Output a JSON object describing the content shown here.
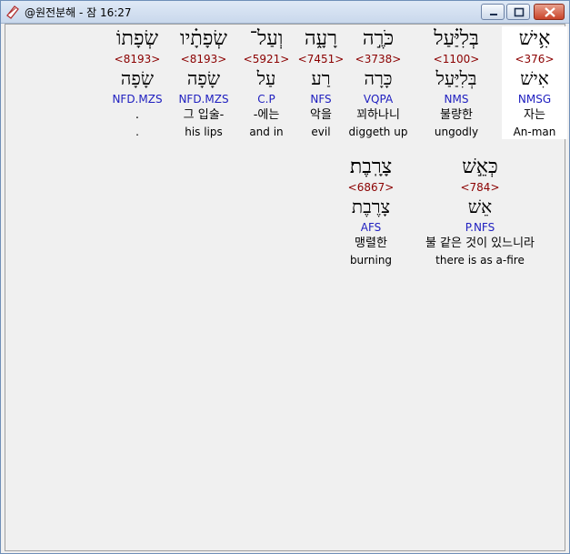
{
  "window": {
    "title": "@원전분해 - 잠 16:27"
  },
  "colors": {
    "strong": "#8b0000",
    "morph": "#2020c0",
    "highlight": "#ffffff"
  },
  "words": [
    {
      "hebrew": "אִ֥ישׁ",
      "strong": "<376>",
      "lexeme": "אִישׁ",
      "morph": "NMSG",
      "korean": "자는",
      "english": "An-man"
    },
    {
      "hebrew": "בְּלִיַּ֗עַל",
      "strong": "<1100>",
      "lexeme": "בְּלִיַּעַל",
      "morph": "NMS",
      "korean": "불량한",
      "english": "ungodly"
    },
    {
      "hebrew": "כֹּרֶ֣ה",
      "strong": "<3738>",
      "lexeme": "כָּרָה",
      "morph": "VQPA",
      "korean": "꾀하나니",
      "english": "diggeth up"
    },
    {
      "hebrew": "רָעָ֑ה",
      "strong": "<7451>",
      "lexeme": "רַע",
      "morph": "NFS",
      "korean": "악을",
      "english": "evil"
    },
    {
      "hebrew": "וְעַל־",
      "strong": "<5921>",
      "lexeme": "עַל",
      "morph": "C.P",
      "korean": "-에는",
      "english": "and in"
    },
    {
      "hebrew": "שְׂפָתָ֗יו",
      "strong": "<8193>",
      "lexeme": "שָׂפָה",
      "morph": "NFD.MZS",
      "korean": "그 입술-",
      "english": "his lips"
    },
    {
      "hebrew": "שְׂפָתוֹ",
      "strong": "<8193>",
      "lexeme": "שָׂפָה",
      "morph": "NFD.MZS",
      "korean": ".",
      "english": "."
    },
    {
      "hebrew": "כְּאֵ֣שׁ",
      "strong": "<784>",
      "lexeme": "אֵשׁ",
      "morph": "P.NFS",
      "korean": "불 같은 것이 있느니라",
      "english": "there is as a-fire"
    },
    {
      "hebrew": "צָרָֽבֶת׃",
      "strong": "<6867>",
      "lexeme": "צָרֶבֶת",
      "morph": "AFS",
      "korean": "맹렬한",
      "english": "burning"
    }
  ]
}
